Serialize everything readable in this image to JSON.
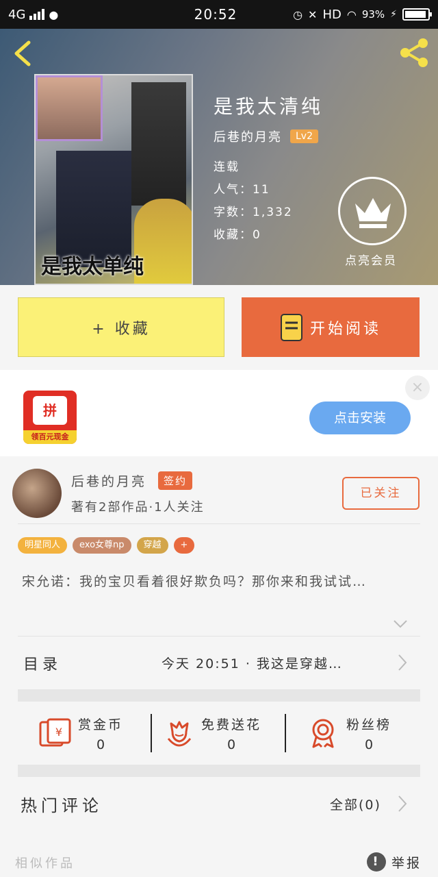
{
  "status_bar": {
    "network": "4G",
    "time": "20:52",
    "hd": "HD",
    "battery_pct": "93%",
    "battery_level": 0.93
  },
  "book": {
    "cover_text": "是我太单纯",
    "title": "是我太清纯",
    "author": "后巷的月亮",
    "level": "Lv2",
    "status": "连载",
    "popularity": "人气：11",
    "word_count": "字数：1,332",
    "favorites": "收藏：0",
    "vip_label": "点亮会员"
  },
  "actions": {
    "favorite": "+ 收藏",
    "read": "开始阅读"
  },
  "ad": {
    "logo_text": "拼",
    "logo_strip": "领百元现金",
    "close": "×",
    "install": "点击安装"
  },
  "author_section": {
    "name": "后巷的月亮",
    "badge": "签约",
    "stats": "著有2部作品·1人关注",
    "follow": "已关注"
  },
  "tags": [
    {
      "label": "明星同人",
      "color": "#f3b23e"
    },
    {
      "label": "exo女尊np",
      "color": "#c98a6a"
    },
    {
      "label": "穿越",
      "color": "#d3a54a"
    },
    {
      "label": "+",
      "color": "#e86a3e"
    }
  ],
  "description": "宋允诺：我的宝贝看着很好欺负吗？那你来和我试试…",
  "toc": {
    "label": "目录",
    "latest": "今天 20:51 · 我这是穿越…"
  },
  "stats": {
    "reward_label": "赏金币",
    "reward_value": "0",
    "flower_label": "免费送花",
    "flower_value": "0",
    "fans_label": "粉丝榜",
    "fans_value": "0"
  },
  "comments": {
    "label": "热门评论",
    "all": "全部(0)"
  },
  "bottom": {
    "similar": "相似作品",
    "report": "举报",
    "report_icon": "!"
  },
  "colors": {
    "accent": "#e86a3e",
    "yellow": "#fbf177",
    "blue": "#6aa9f0"
  },
  "icons": [
    "back-icon",
    "share-icon",
    "crown-icon",
    "book-icon",
    "close-icon",
    "chevron-down-icon",
    "chevron-right-icon",
    "red-packet-icon",
    "flower-icon",
    "medal-icon",
    "report-icon"
  ]
}
